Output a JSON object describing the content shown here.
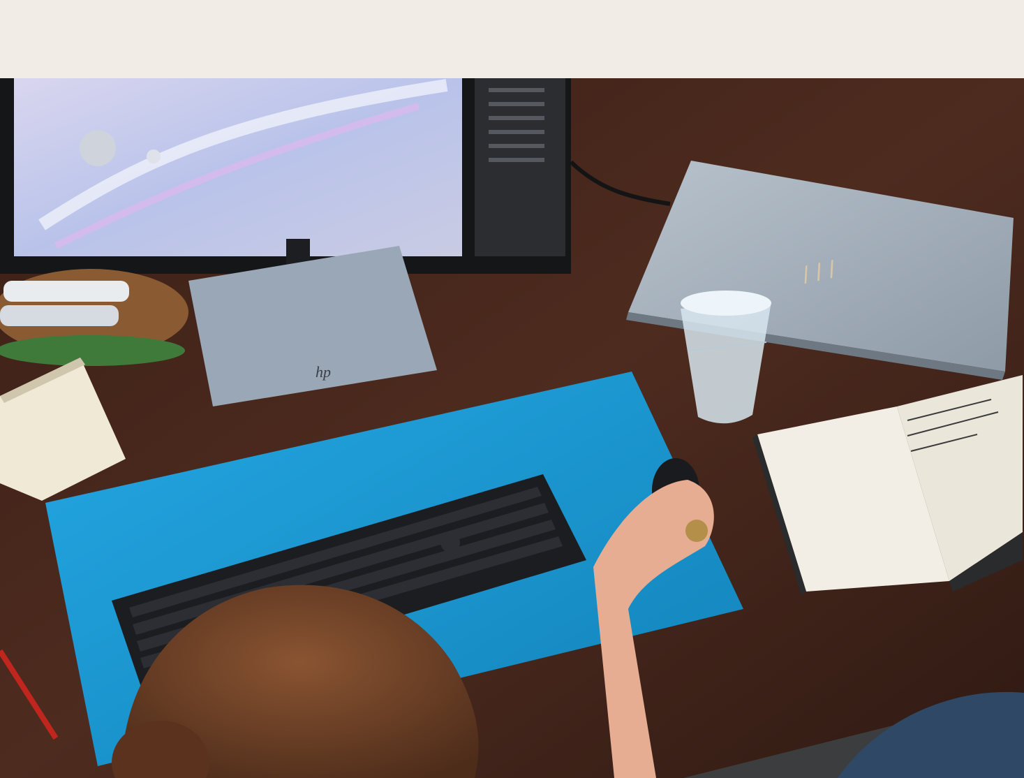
{
  "header": {
    "heading_text": ""
  },
  "photo": {
    "subject": "desk-workspace-photo",
    "colors": {
      "desk": "#4a2a1e",
      "desk_dark": "#2e1a12",
      "mousepad": "#1f9bd6",
      "laptop": "#a9b4bf",
      "monitor_base": "#9aa7b6",
      "keyboard": "#1c1d20",
      "hair": "#6b3f25",
      "header_bg": "#f1ede6"
    }
  }
}
